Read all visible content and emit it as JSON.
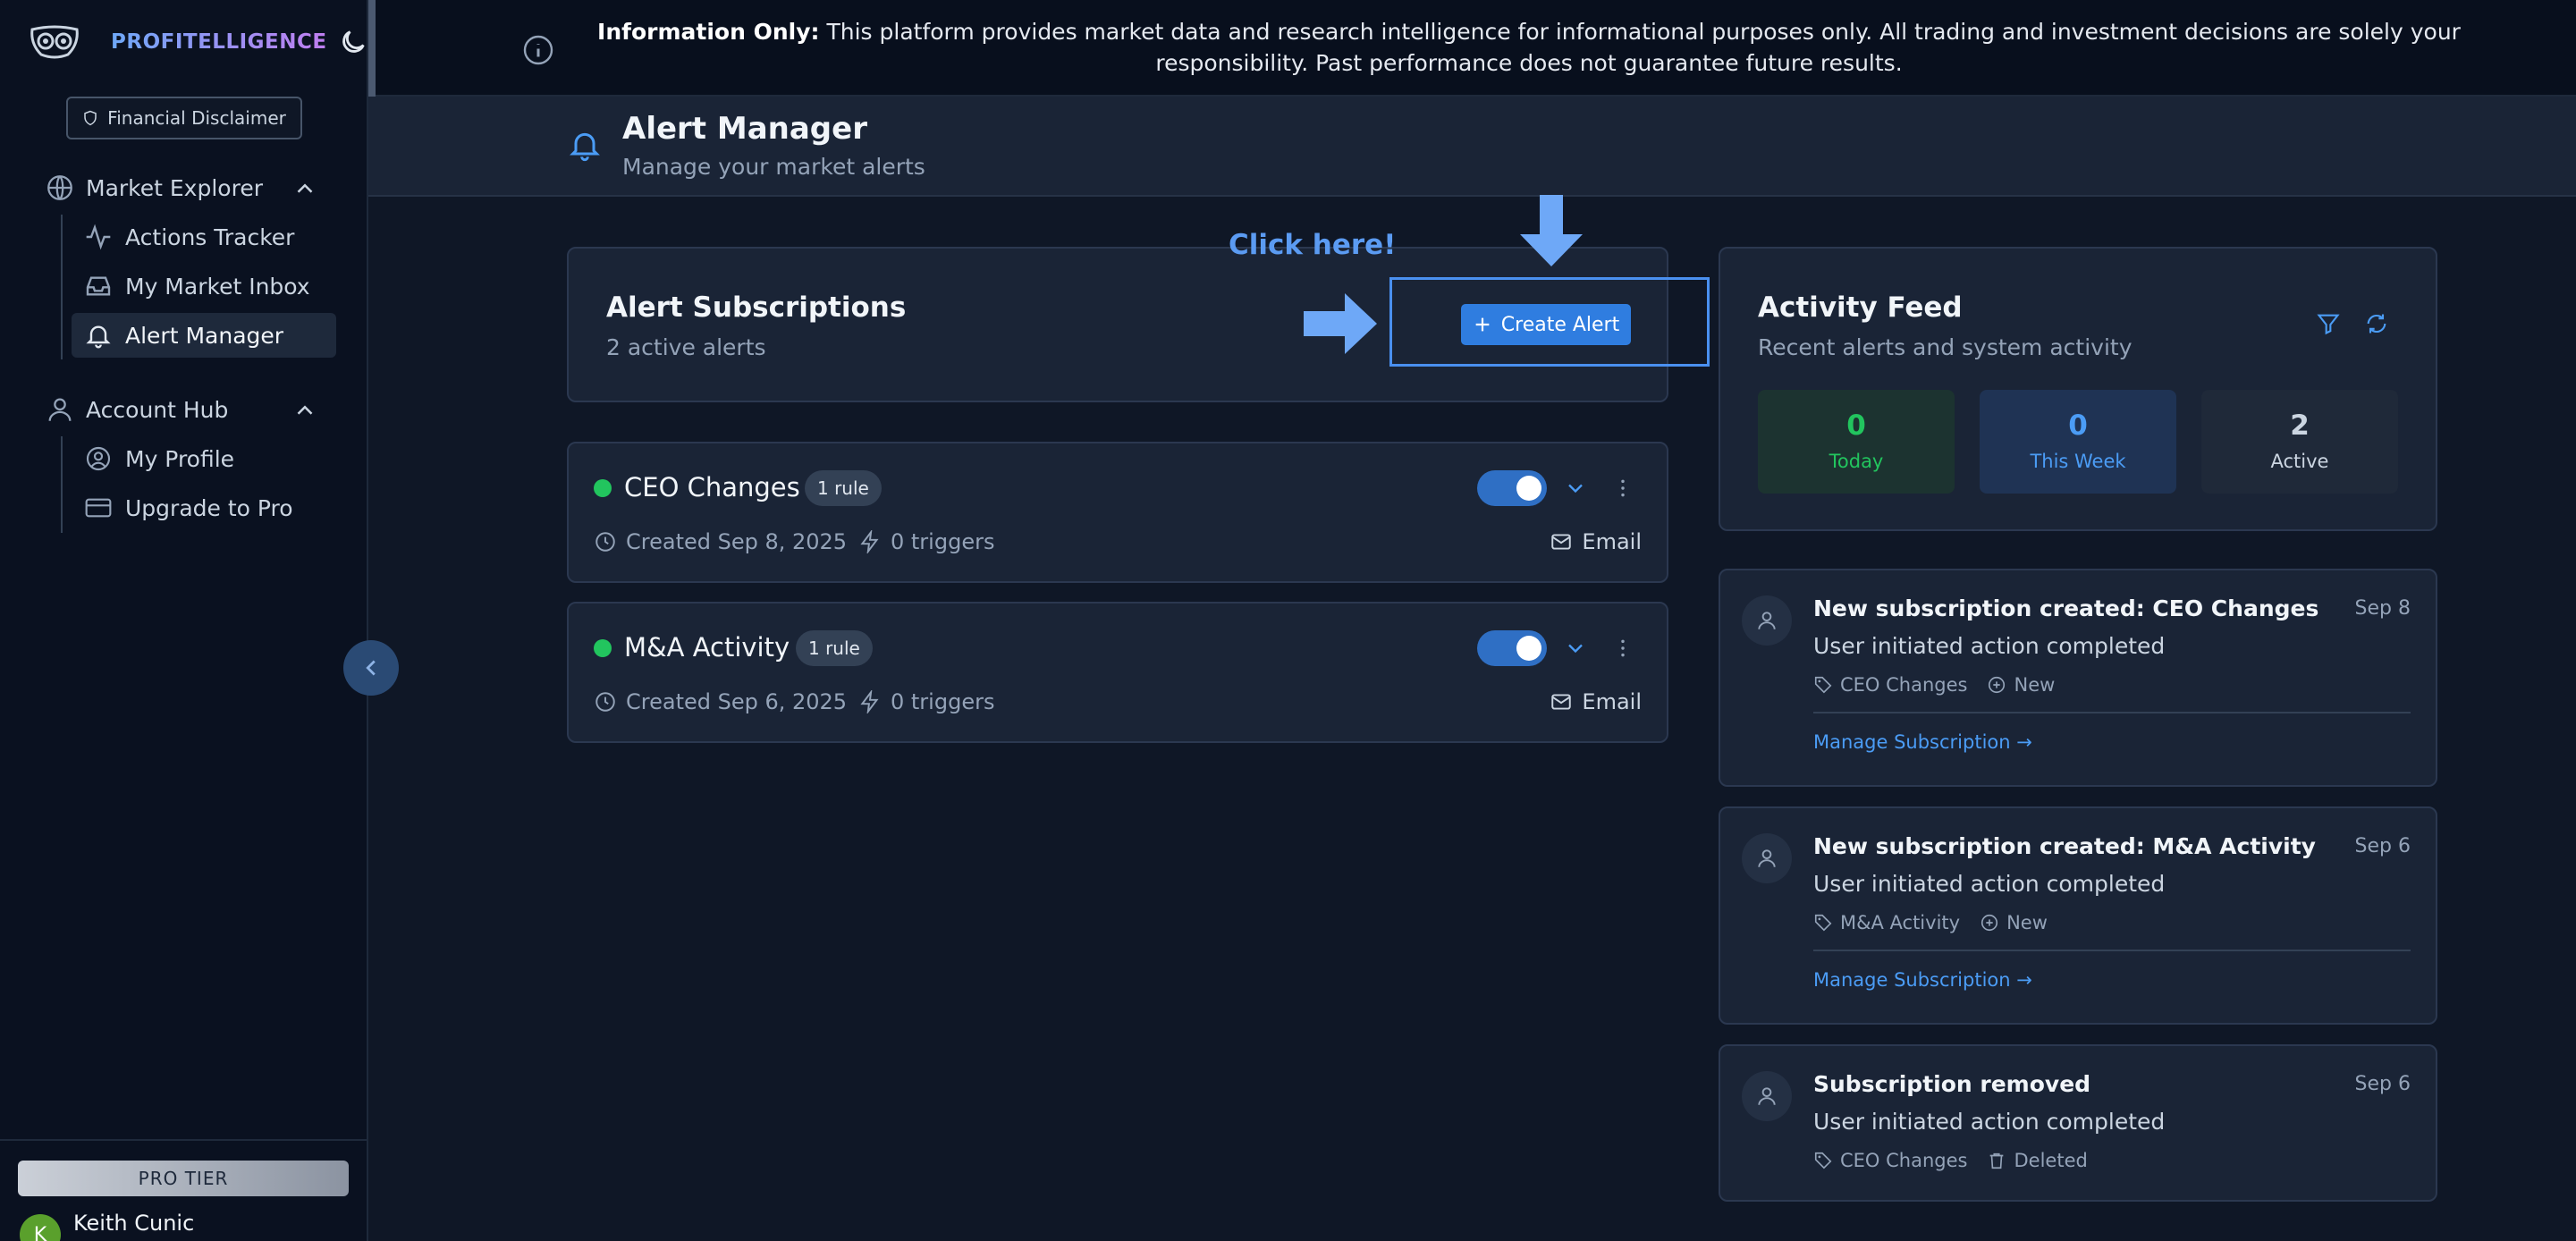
{
  "brand": {
    "name": "PROFITELLIGENCE"
  },
  "sidebar": {
    "disclaimer_label": "Financial Disclaimer",
    "groups": [
      {
        "label": "Market Explorer",
        "items": [
          {
            "label": "Actions Tracker"
          },
          {
            "label": "My Market Inbox"
          },
          {
            "label": "Alert Manager",
            "active": true
          }
        ]
      },
      {
        "label": "Account Hub",
        "items": [
          {
            "label": "My Profile"
          },
          {
            "label": "Upgrade to Pro"
          }
        ]
      }
    ],
    "tier": "PRO TIER",
    "user": {
      "initial": "K",
      "name": "Keith Cunic"
    }
  },
  "banner": {
    "label": "Information Only:",
    "text": " This platform provides market data and research intelligence for informational purposes only. All trading and investment decisions are solely your responsibility. Past performance does not guarantee future results."
  },
  "header": {
    "title": "Alert Manager",
    "subtitle": "Manage your market alerts"
  },
  "subscriptions": {
    "title": "Alert Subscriptions",
    "count_text": "2 active alerts",
    "create_label": "Create Alert",
    "hint": "Click here!",
    "alerts": [
      {
        "name": "CEO Changes",
        "rules": "1 rule",
        "created": "Created Sep 8, 2025",
        "triggers": "0 triggers",
        "channel": "Email",
        "enabled": true
      },
      {
        "name": "M&A Activity",
        "rules": "1 rule",
        "created": "Created Sep 6, 2025",
        "triggers": "0 triggers",
        "channel": "Email",
        "enabled": true
      }
    ]
  },
  "feed": {
    "title": "Activity Feed",
    "subtitle": "Recent alerts and system activity",
    "stats": [
      {
        "value": "0",
        "label": "Today",
        "color": "#22c55e"
      },
      {
        "value": "0",
        "label": "This Week",
        "color": "#4b9cf5"
      },
      {
        "value": "2",
        "label": "Active",
        "color": "#cbd5e1"
      }
    ],
    "events": [
      {
        "title": "New subscription created: CEO Changes",
        "date": "Sep 8",
        "desc": "User initiated action completed",
        "tag": "CEO Changes",
        "status": "New",
        "link": "Manage Subscription →"
      },
      {
        "title": "New subscription created: M&A Activity",
        "date": "Sep 6",
        "desc": "User initiated action completed",
        "tag": "M&A Activity",
        "status": "New",
        "link": "Manage Subscription →"
      },
      {
        "title": "Subscription removed",
        "date": "Sep 6",
        "desc": "User initiated action completed",
        "tag": "CEO Changes",
        "status": "Deleted"
      }
    ]
  }
}
